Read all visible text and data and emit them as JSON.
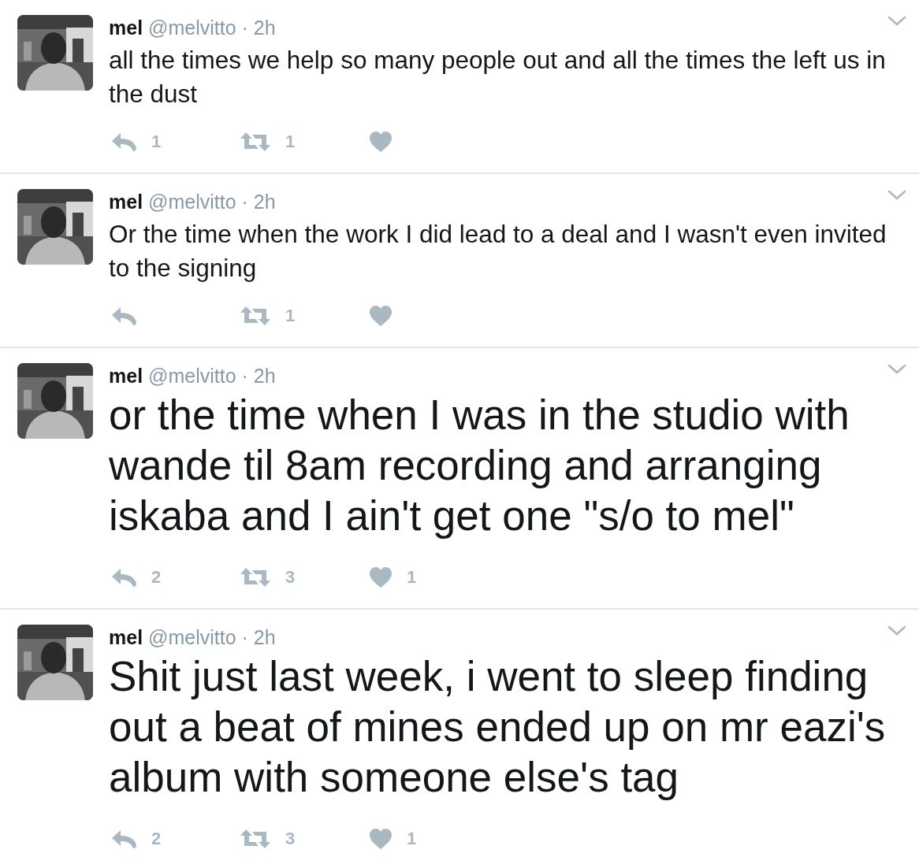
{
  "tweets": [
    {
      "name": "mel",
      "handle": "@melvitto",
      "time": "· 2h",
      "kind": "normal",
      "text": "all the times we help so many people out and all the times the left us in the dust",
      "replies": "1",
      "retweets": "1"
    },
    {
      "name": "mel",
      "handle": "@melvitto",
      "time": "· 2h",
      "kind": "normal",
      "text": "Or the time when the work I did lead to a deal and I wasn't even invited to the signing",
      "retweets": "1"
    },
    {
      "name": "mel",
      "handle": "@melvitto",
      "time": "· 2h",
      "kind": "large",
      "text": "or the time when I was in the studio with wande til 8am recording and arranging iskaba and I ain't get one \"s/o to mel\"",
      "replies": "2",
      "retweets": "3",
      "likes": "1"
    },
    {
      "name": "mel",
      "handle": "@melvitto",
      "time": "· 2h",
      "kind": "large",
      "text": "Shit just last week, i went to sleep finding out a beat of mines ended up on mr eazi's album with someone else's tag",
      "replies": "2",
      "retweets": "3",
      "likes": "1"
    }
  ]
}
